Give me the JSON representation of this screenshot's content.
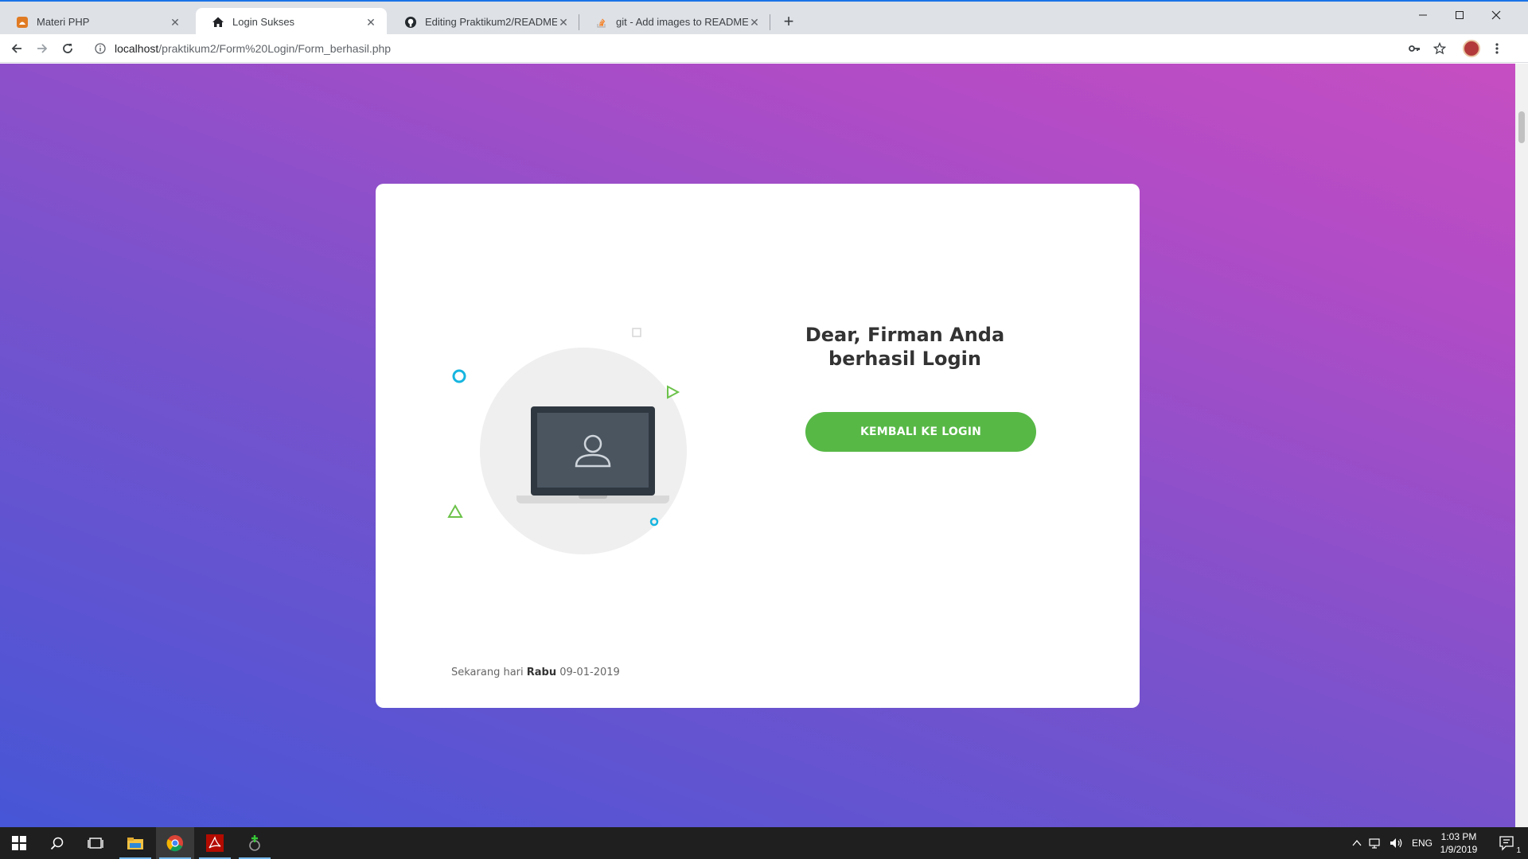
{
  "browser": {
    "tabs": [
      {
        "title": "Materi PHP",
        "icon": "blogger-orange-icon",
        "active": false
      },
      {
        "title": "Login Sukses",
        "icon": "home-icon",
        "active": true
      },
      {
        "title": "Editing Praktikum2/README.md",
        "icon": "github-icon",
        "active": false
      },
      {
        "title": "git - Add images to README.md",
        "icon": "stackoverflow-icon",
        "active": false
      }
    ],
    "new_tab_label": "+",
    "url_host": "localhost",
    "url_path": "/praktikum2/Form%20Login/Form_berhasil.php"
  },
  "page": {
    "message_line1": "Dear, Firman Anda",
    "message_line2": "berhasil Login",
    "back_button_label": "KEMBALI KE LOGIN",
    "date_prefix": "Sekarang hari",
    "day_name": "Rabu",
    "date_value": "09-01-2019",
    "colors": {
      "gradient_start": "#4656d6",
      "gradient_end": "#c64ec2",
      "button_green": "#57b846",
      "decor_cyan": "#16b5e0",
      "decor_green": "#6cc24a"
    }
  },
  "taskbar": {
    "items": [
      "windows-start-icon",
      "search-icon",
      "task-view-icon",
      "file-explorer-icon",
      "chrome-icon",
      "acrobat-icon",
      "xampp-icon"
    ],
    "language": "ENG",
    "time": "1:03 PM",
    "date": "1/9/2019",
    "notification_count": "1"
  }
}
